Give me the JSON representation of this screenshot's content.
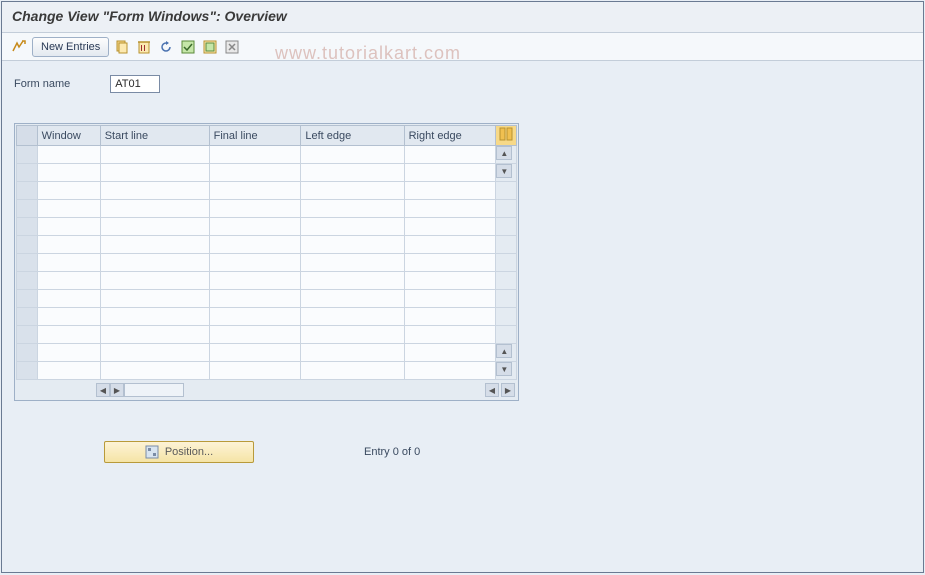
{
  "title": "Change View \"Form Windows\": Overview",
  "toolbar": {
    "new_entries_label": "New Entries"
  },
  "form": {
    "name_label": "Form name",
    "name_value": "AT01"
  },
  "table": {
    "columns": [
      "Window",
      "Start line",
      "Final line",
      "Left edge",
      "Right edge"
    ],
    "row_count": 13
  },
  "footer": {
    "position_label": "Position...",
    "entry_text": "Entry 0 of 0"
  },
  "watermark": "www.tutorialkart.com"
}
